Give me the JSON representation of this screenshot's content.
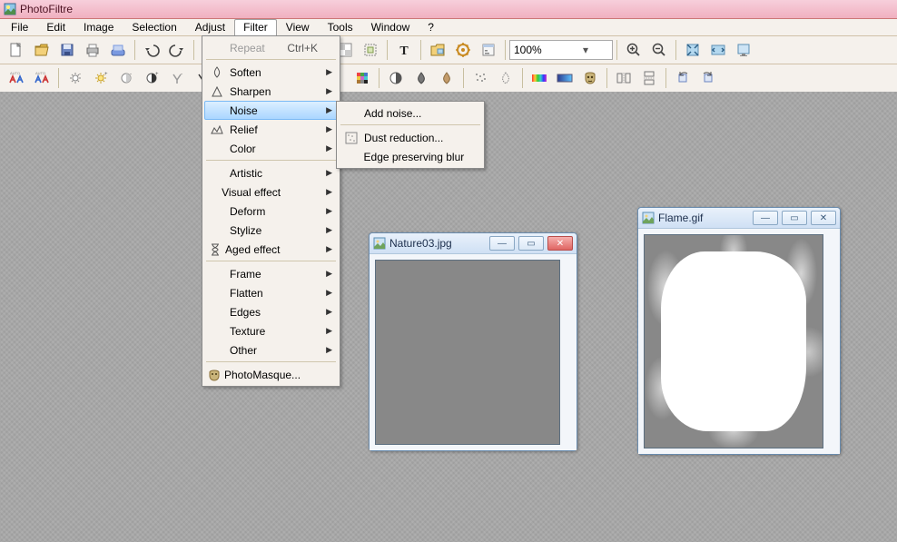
{
  "app": {
    "title": "PhotoFiltre"
  },
  "menu": {
    "items": [
      "File",
      "Edit",
      "Image",
      "Selection",
      "Adjust",
      "Filter",
      "View",
      "Tools",
      "Window",
      "?"
    ],
    "open_index": 5
  },
  "filter_menu": {
    "repeat": {
      "label": "Repeat",
      "shortcut": "Ctrl+K"
    },
    "soften": "Soften",
    "sharpen": "Sharpen",
    "noise": "Noise",
    "relief": "Relief",
    "color": "Color",
    "artistic": "Artistic",
    "visual_effect": "Visual effect",
    "deform": "Deform",
    "stylize": "Stylize",
    "aged_effect": "Aged effect",
    "frame": "Frame",
    "flatten": "Flatten",
    "edges": "Edges",
    "texture": "Texture",
    "other": "Other",
    "photomasque": "PhotoMasque..."
  },
  "noise_submenu": {
    "add_noise": "Add noise...",
    "dust_reduction": "Dust reduction...",
    "edge_preserving_blur": "Edge preserving blur"
  },
  "toolbar": {
    "zoom_value": "100%"
  },
  "mdi": {
    "nature": {
      "title": "Nature03.jpg"
    },
    "flame": {
      "title": "Flame.gif"
    }
  }
}
